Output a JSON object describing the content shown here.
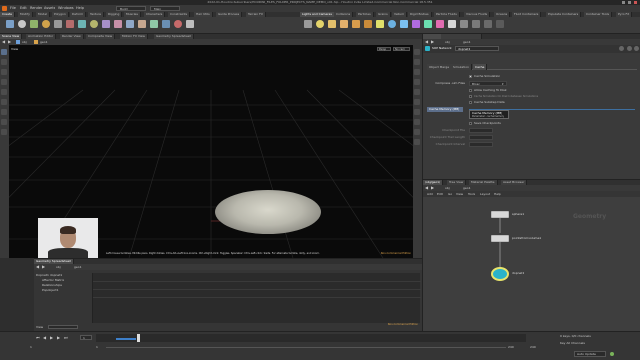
{
  "app": {
    "title": "2022-01-Houdini-Subscribers/HOUDINI_FILES_FOLDER_PROJECTS_NAME_DEMO_v01.hip - Houdini Indie Limited-Commercial Non-Commercial 18.5.351",
    "menu": [
      "File",
      "Edit",
      "Render",
      "Assets",
      "Windows",
      "Help"
    ],
    "build_label": "Build",
    "main_label": "Main"
  },
  "shelf_tabs": [
    "Create",
    "Modify",
    "Model",
    "Polygon",
    "Deform",
    "Texture",
    "Rigging",
    "Muscles",
    "Characters",
    "Constraints",
    "Hair Utils",
    "Guide Process",
    "Terrain FX"
  ],
  "shelf_tabs_right": [
    "Lights and Cameras",
    "Collisions",
    "Particles",
    "Grains",
    "Vellum",
    "Rigid Bodies",
    "Particle Fluids",
    "Viscous Fluids",
    "Oceans",
    "Fluid Containers",
    "Populate Containers",
    "Container Tools",
    "Pyro FX"
  ],
  "pane_tabs": [
    "Scene View",
    "Animation Editor",
    "Render View",
    "Composite View",
    "Motion FX View",
    "Geometry Spreadsheet"
  ],
  "viewport": {
    "path": "obj",
    "node": "geo1",
    "view_label": "View",
    "camera_label": "Persp",
    "cam_label": "No cam",
    "status_text": "Left mouse tumbles. Middle pans. Right dollies. Ctrl+Alt+Left box-zooms. Ctrl+Right-click: Toggles. Spacebar: Ctrl+Left-click: Sisits. For alternate tumble, dolly, and zoom.",
    "watermark": "Non-Commercial Edition"
  },
  "params": {
    "header_type": "SOP Network",
    "header_name": "dopnet1",
    "path": "obj",
    "node": "geo1",
    "tabs": [
      "Object Merge",
      "Simulation",
      "Cache"
    ],
    "active_tab": "Cache",
    "cache_simulation_label": "Cache Simulation",
    "compress_label": "Compress .sim Files",
    "compress_value": "Blosc",
    "allow_caching_label": "Allow Caching To Disk",
    "cache_sim_to_disk_label": "Cache Simulation On Disk Inbetween Simulations",
    "cache_substep_label": "Cache Substep Data",
    "cache_memory_label": "Cache Memory (MB)",
    "tooltip_title": "Cache Memory (MB)",
    "tooltip_sub": "Parameter: cachememory",
    "save_checkpoints_label": "Save Checkpoints",
    "checkpoint_file_label": "Checkpoint File",
    "checkpoint_trail_label": "Checkpoint Trail Length",
    "checkpoint_interval_label": "Checkpoint Interval"
  },
  "network": {
    "tabs": [
      "/obj/geo1/",
      "Tree View",
      "Material Palette",
      "Asset Browser"
    ],
    "path": "obj",
    "node": "geo1",
    "menu": [
      "Add",
      "Edit",
      "Go",
      "View",
      "Tools",
      "Layout",
      "Help"
    ],
    "context_label": "Geometry",
    "nodes": [
      {
        "name": "sphere1",
        "color": "#d8d8d8"
      },
      {
        "name": "pointsfromvolume1",
        "color": "#d8d8d8"
      },
      {
        "name": "dopnet1",
        "color": "#2bb3c9"
      }
    ]
  },
  "spreadsheet": {
    "tab": "Geometry Spreadsheet",
    "path": "obj",
    "node": "geo1",
    "tree": [
      "Dopnet1 dopnet1",
      "Affector Matrix",
      "Relationships",
      "Popobject1"
    ],
    "view_label": "View",
    "watermark": "Non-Commercial Edition"
  },
  "timeline": {
    "frame": "1",
    "start": "1",
    "end": "240",
    "end2": "240",
    "cur_frame": "1",
    "key_label": "0 keys, 0/0 channels",
    "key_all_label": "Key All Channels",
    "auto_update_label": "Auto Update"
  }
}
